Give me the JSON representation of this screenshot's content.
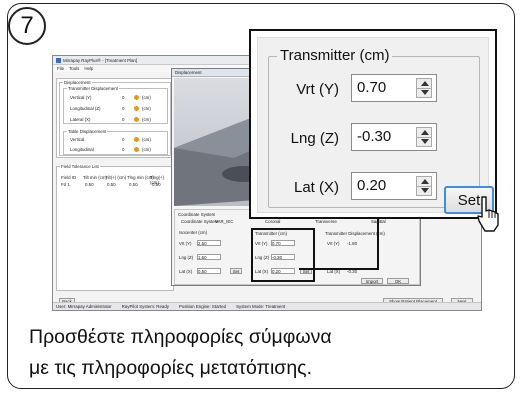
{
  "step": {
    "number": "7"
  },
  "caption": {
    "line1": "Προσθέστε πληροφορίες σύμφωνα",
    "line2": "με τις πληροφορίες μετατόπισης."
  },
  "screenshot": {
    "window_title": "Mirrapay RayPlus® - [Treatment Plan]",
    "menu": [
      "File",
      "Tools",
      "Help"
    ],
    "displacement_panel": {
      "title": "Displacement",
      "transmitter_group": "Transmitter Displacement",
      "rows": [
        {
          "label": "Vertical (Y)",
          "value": "0",
          "unit": "(cm)"
        },
        {
          "label": "Longitudinal (Z)",
          "value": "0",
          "unit": "(cm)"
        },
        {
          "label": "Lateral (X)",
          "value": "0",
          "unit": "(cm)"
        }
      ],
      "table_group": "Table Displacement",
      "table_rows": [
        {
          "label": "Vertical",
          "value": "0",
          "unit": "(cm)"
        },
        {
          "label": "Longitudinal",
          "value": "0",
          "unit": "(cm)"
        }
      ]
    },
    "tolerance_panel": {
      "title": "Field Tolerance List",
      "headers": [
        "Field ID",
        "Tilt min (cm)",
        "Tilt(+) (cm)",
        "Tlng min (cm)",
        "Tlng(+) (cm)"
      ],
      "row": [
        "Fd 1",
        "0.50",
        "0.50",
        "0.50",
        "0.50"
      ]
    },
    "dialog": {
      "title": "Displacement",
      "coord_label": "Coordinate System",
      "coord_system_label": "Coordinate System:",
      "coord_system_value": "VAR_IEC",
      "view_label": "View",
      "view_options": [
        "Coronal",
        "Transverse",
        "Sagittal"
      ],
      "isocenter_title": "Isocenter (cm)",
      "isocenter_rows": [
        {
          "label": "Vrt (Y)",
          "value": "2.50"
        },
        {
          "label": "Lng (Z)",
          "value": "1.50"
        },
        {
          "label": "Lat (X)",
          "value": "0.50"
        }
      ],
      "isocenter_set": "Set",
      "transmitter_title": "Transmitter (cm)",
      "transmitter_rows": [
        {
          "label": "Vrt (Y)",
          "value": "0.70"
        },
        {
          "label": "Lng (Z)",
          "value": "-0.30"
        },
        {
          "label": "Lat (X)",
          "value": "0.20"
        }
      ],
      "transmitter_set": "Set",
      "tdisp_title": "Transmitter Displacement (cm)",
      "tdisp_rows": [
        {
          "label": "Vrt (Y)",
          "value": "-1.80"
        },
        {
          "label": "Lat (X)",
          "value": "-0.30"
        }
      ],
      "import_label": "Import",
      "ok_label": "OK"
    },
    "buttons": {
      "back": "Back",
      "show_patient": "Show Patient Placement",
      "next": "Next"
    },
    "status": [
      "User: Mirrapay Administrator",
      "RayPilot System: Ready",
      "Position Engine: Started",
      "System Mode: Treatment"
    ]
  },
  "zoom": {
    "group_title": "Transmitter (cm)",
    "fields": [
      {
        "label": "Vrt (Y)",
        "value": "0.70"
      },
      {
        "label": "Lng (Z)",
        "value": "-0.30"
      },
      {
        "label": "Lat (X)",
        "value": "0.20"
      }
    ],
    "set_label": "Set"
  },
  "colors": {
    "accent": "#3a8ee6",
    "warning_dot": "#e39a1c"
  }
}
